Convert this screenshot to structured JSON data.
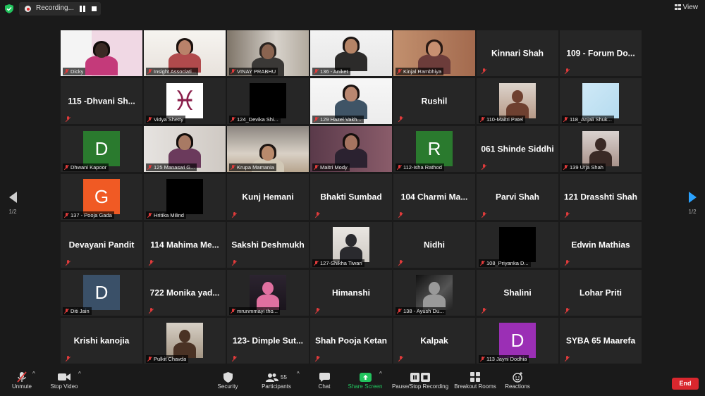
{
  "top": {
    "recording_label": "Recording...",
    "view_label": "View"
  },
  "pager": {
    "left": "1/2",
    "right": "1/2"
  },
  "tiles": [
    {
      "type": "video",
      "label": "Dicky",
      "theme": "poster",
      "active": true
    },
    {
      "type": "video",
      "label": "Insight Associati...",
      "theme": "room"
    },
    {
      "type": "video",
      "label": "VINAY PRABHU",
      "theme": "man-room"
    },
    {
      "type": "video",
      "label": "136 - Aniket",
      "theme": "man-white"
    },
    {
      "type": "video",
      "label": "Kinjal Rambhiya",
      "theme": "warm"
    },
    {
      "type": "name",
      "name": "Kinnari Shah"
    },
    {
      "type": "name",
      "name": "109 - Forum Do..."
    },
    {
      "type": "name",
      "name": "115 -Dhvani Sh..."
    },
    {
      "type": "pic",
      "label": "Vidya Shetty",
      "pic": "pisces"
    },
    {
      "type": "pic",
      "label": "124_Devika Shi...",
      "pic": "black"
    },
    {
      "type": "video",
      "label": "129 Hazel Vakh...",
      "theme": "woman-white"
    },
    {
      "type": "name",
      "name": "Rushil"
    },
    {
      "type": "pic",
      "label": "110-Maitri Patel",
      "pic": "photo-woman"
    },
    {
      "type": "pic",
      "label": "118_Anjali Shuk...",
      "pic": "anjali"
    },
    {
      "type": "avatar",
      "label": "Dhwani Kapoor",
      "letter": "D",
      "color": "#2a7a2e"
    },
    {
      "type": "video",
      "label": "125 Manaswi G...",
      "theme": "woman-room"
    },
    {
      "type": "video",
      "label": "Krupa Mamania",
      "theme": "kid-room"
    },
    {
      "type": "video",
      "label": "Maitri Mody",
      "theme": "woman-purple"
    },
    {
      "type": "avatar",
      "label": "112-Isha Rathod",
      "letter": "R",
      "color": "#2a7a2e"
    },
    {
      "type": "name",
      "name": "061 Shinde Siddhi"
    },
    {
      "type": "pic",
      "label": "139 Urja Shah",
      "pic": "photo-girl"
    },
    {
      "type": "avatar",
      "label": "137 - Pooja Gada",
      "letter": "G",
      "color": "#f05a24"
    },
    {
      "type": "pic",
      "label": "Hritika Milind",
      "pic": "black"
    },
    {
      "type": "name",
      "name": "Kunj Hemani"
    },
    {
      "type": "name",
      "name": "Bhakti Sumbad"
    },
    {
      "type": "name",
      "name": "104 Charmi Ma..."
    },
    {
      "type": "name",
      "name": "Parvi Shah"
    },
    {
      "type": "name",
      "name": "121 Drasshti Shah"
    },
    {
      "type": "name",
      "name": "Devayani Pandit"
    },
    {
      "type": "name",
      "name": "114 Mahima Me..."
    },
    {
      "type": "name",
      "name": "Sakshi Deshmukh"
    },
    {
      "type": "pic",
      "label": "127-Shikha Tiwari",
      "pic": "photo-suit"
    },
    {
      "type": "name",
      "name": "Nidhi"
    },
    {
      "type": "pic",
      "label": "108_Priyanka D...",
      "pic": "black"
    },
    {
      "type": "name",
      "name": "Edwin Mathias"
    },
    {
      "type": "avatar",
      "label": "Diti Jain",
      "letter": "D",
      "color": "#3a5068"
    },
    {
      "type": "name",
      "name": "722 Monika yad..."
    },
    {
      "type": "pic",
      "label": "mrunmmayi tho...",
      "pic": "photo-pink"
    },
    {
      "type": "name",
      "name": "Himanshi"
    },
    {
      "type": "pic",
      "label": "138 - Ayush Du...",
      "pic": "photo-bw"
    },
    {
      "type": "name",
      "name": "Shalini"
    },
    {
      "type": "name",
      "name": "Lohar Priti"
    },
    {
      "type": "name",
      "name": "Krishi kanojia"
    },
    {
      "type": "pic",
      "label": "Pulkit Chavda",
      "pic": "photo-guitar"
    },
    {
      "type": "name",
      "name": "123- Dimple Sut..."
    },
    {
      "type": "name",
      "name": "Shah Pooja Ketan"
    },
    {
      "type": "name",
      "name": "Kalpak"
    },
    {
      "type": "avatar",
      "label": "113 Jayni Dodhia",
      "letter": "D",
      "color": "#9b2fb5"
    },
    {
      "type": "name",
      "name": "SYBA 65 Maarefa"
    }
  ],
  "toolbar": {
    "unmute": "Unmute",
    "stop_video": "Stop Video",
    "security": "Security",
    "participants": "Participants",
    "participants_count": "55",
    "chat": "Chat",
    "share_screen": "Share Screen",
    "pause_stop_recording": "Pause/Stop Recording",
    "breakout_rooms": "Breakout Rooms",
    "reactions": "Reactions",
    "end": "End"
  },
  "colors": {
    "share_green": "#22c45e",
    "end_red": "#d9272e",
    "active_border": "#d6de3a",
    "pager_blue": "#2aa2ff"
  }
}
